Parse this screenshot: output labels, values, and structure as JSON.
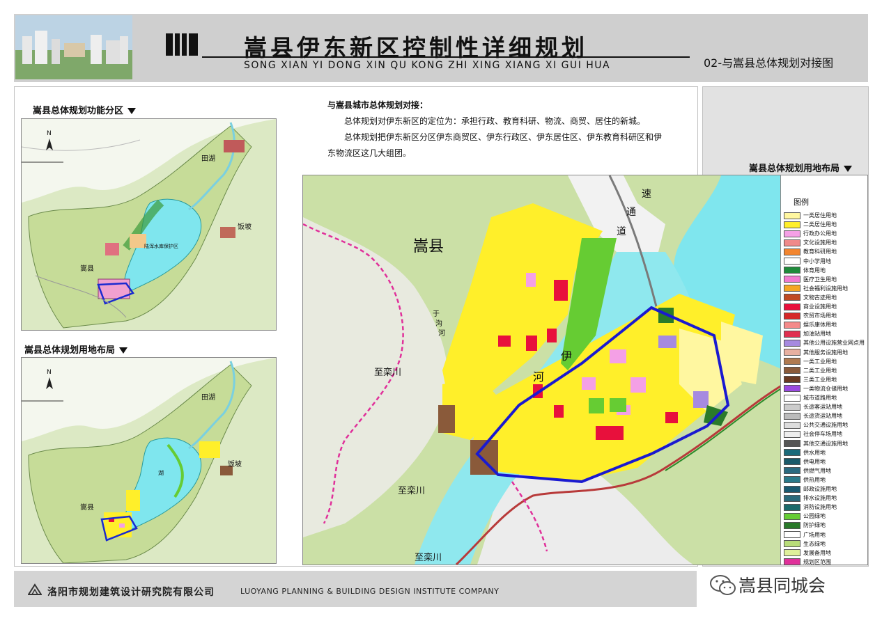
{
  "header": {
    "title": "嵩县伊东新区控制性详细规划",
    "subtitle_en": "SONG XIAN YI DONG XIN QU KONG ZHI XING XIANG XI GUI HUA",
    "sheet_title": "02-与嵩县总体规划对接图"
  },
  "sections": {
    "functional_zoning": "嵩县总体规划功能分区",
    "land_use_small": "嵩县总体规划用地布局",
    "land_use_right": "嵩县总体规划用地布局"
  },
  "text": {
    "heading": "与嵩县城市总体规划对接：",
    "para1": "总体规划对伊东新区的定位为：承担行政、教育科研、物流、商贸、居住的新城。",
    "para2": "总体规划把伊东新区分区伊东商贸区、伊东行政区、伊东居住区、伊东教育科研区和伊东物流区这几大组团。"
  },
  "map1": {
    "north": "N",
    "labels": {
      "tianhu": "田湖",
      "fanpo": "饭坡",
      "songxian": "嵩县",
      "lake": "陆浑水库保护区"
    }
  },
  "map2": {
    "north": "N",
    "labels": {
      "tianhu": "田湖",
      "fanpo": "饭坡",
      "songxian": "嵩县",
      "lake": "湖"
    }
  },
  "main_map": {
    "labels": {
      "county": "嵩县",
      "expressway_1": "速",
      "expressway_2": "通",
      "expressway_3": "道",
      "to_luanchuan_1": "至栾川",
      "to_luanchuan_2": "至栾川",
      "to_luanchuan_3": "至栾川",
      "river_1": "伊",
      "river_2": "河",
      "gou_1": "于",
      "gou_2": "沟",
      "gou_3": "河"
    }
  },
  "legend": {
    "title": "图例",
    "items": [
      {
        "label": "一类居住用地",
        "color": "#fff7a0"
      },
      {
        "label": "二类居住用地",
        "color": "#ffef2a"
      },
      {
        "label": "行政办公用地",
        "color": "#f4a0e6"
      },
      {
        "label": "文化设施用地",
        "color": "#f08a8a"
      },
      {
        "label": "教育科研用地",
        "color": "#f2852f"
      },
      {
        "label": "中小学用地",
        "color": "#ffffff"
      },
      {
        "label": "体育用地",
        "color": "#1e8a3a"
      },
      {
        "label": "医疗卫生用地",
        "color": "#f07ad0"
      },
      {
        "label": "社会福利设施用地",
        "color": "#f5a623"
      },
      {
        "label": "文物古迹用地",
        "color": "#c04a22"
      },
      {
        "label": "商业设施用地",
        "color": "#e8103c"
      },
      {
        "label": "农贸市场用地",
        "color": "#d62828"
      },
      {
        "label": "娱乐康体用地",
        "color": "#f48a8a"
      },
      {
        "label": "加油站用地",
        "color": "#e03050"
      },
      {
        "label": "其他公用设施营业网点用",
        "color": "#a68ae0"
      },
      {
        "label": "其他服务设施用地",
        "color": "#e8b0a0"
      },
      {
        "label": "一类工业用地",
        "color": "#b07a50"
      },
      {
        "label": "二类工业用地",
        "color": "#8a5a3a"
      },
      {
        "label": "三类工业用地",
        "color": "#6a3a22"
      },
      {
        "label": "一类物流仓储用地",
        "color": "#9a4ae0"
      },
      {
        "label": "城市道路用地",
        "color": "#ffffff"
      },
      {
        "label": "长途客运站用地",
        "color": "#cccccc"
      },
      {
        "label": "长途货运站用地",
        "color": "#bbbbbb"
      },
      {
        "label": "公共交通设施用地",
        "color": "#dddddd"
      },
      {
        "label": "社会停车场用地",
        "color": "#eeeeee"
      },
      {
        "label": "其他交通设施用地",
        "color": "#555555"
      },
      {
        "label": "供水用地",
        "color": "#1a6a7a"
      },
      {
        "label": "供电用地",
        "color": "#1a5a6a"
      },
      {
        "label": "供燃气用地",
        "color": "#2a6a80"
      },
      {
        "label": "供热用地",
        "color": "#2a7a8a"
      },
      {
        "label": "邮政设施用地",
        "color": "#1a5a70"
      },
      {
        "label": "排水设施用地",
        "color": "#2a6a7a"
      },
      {
        "label": "消防设施用地",
        "color": "#1a6a6a"
      },
      {
        "label": "公园绿地",
        "color": "#66cc33"
      },
      {
        "label": "防护绿地",
        "color": "#2a7a2a"
      },
      {
        "label": "广场用地",
        "color": "#ffffff"
      },
      {
        "label": "生态绿地",
        "color": "#b8dc78"
      },
      {
        "label": "发展备用地",
        "color": "#dff09a"
      },
      {
        "label": "规划区范围",
        "color": "#e0309a"
      }
    ]
  },
  "footer": {
    "company_cn": "洛阳市规划建筑设计研究院有限公司",
    "company_en": "LUOYANG PLANNING & BUILDING DESIGN INSTITUTE COMPANY"
  },
  "watermark": "嵩县同城会"
}
